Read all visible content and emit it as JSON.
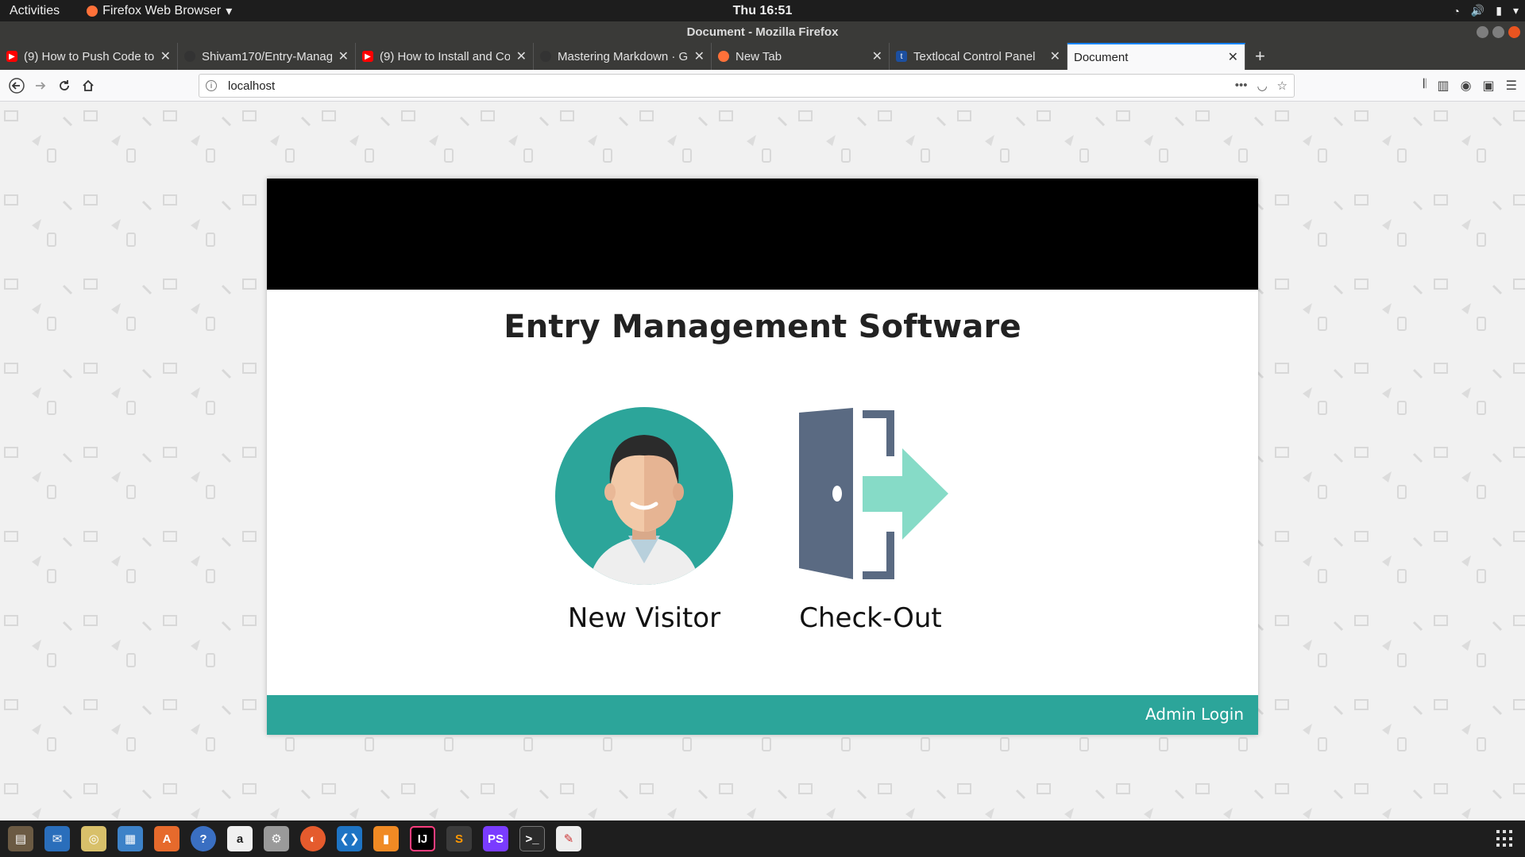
{
  "topbar": {
    "activities": "Activities",
    "app_name": "Firefox Web Browser",
    "clock": "Thu 16:51"
  },
  "window": {
    "title": "Document - Mozilla Firefox"
  },
  "tabs": [
    {
      "label": "(9) How to Push Code to",
      "favicon": "youtube-icon",
      "color": "#ff0000"
    },
    {
      "label": "Shivam170/Entry-Manag",
      "favicon": "github-icon",
      "color": "#333333"
    },
    {
      "label": "(9) How to Install and Co",
      "favicon": "youtube-icon",
      "color": "#ff0000"
    },
    {
      "label": "Mastering Markdown · G",
      "favicon": "github-icon",
      "color": "#333333"
    },
    {
      "label": "New Tab",
      "favicon": "firefox-icon",
      "color": "#ff7139"
    },
    {
      "label": "Textlocal Control Panel",
      "favicon": "textlocal-icon",
      "color": "#1c4fa0"
    },
    {
      "label": "Document",
      "favicon": "none",
      "color": "#f9f9fa",
      "active": true
    }
  ],
  "navbar": {
    "url": "localhost"
  },
  "page": {
    "title": "Entry Management Software",
    "new_visitor_label": "New Visitor",
    "checkout_label": "Check-Out",
    "admin_login": "Admin Login",
    "accent_color": "#2ca59a"
  },
  "taskbar": {
    "apps": [
      "files-icon",
      "thunderbird-icon",
      "rhythmbox-icon",
      "libreoffice-writer-icon",
      "software-center-icon",
      "help-icon",
      "amazon-icon",
      "settings-icon",
      "firefox-icon",
      "vscode-icon",
      "sublime-merge-icon",
      "intellij-icon",
      "sublime-text-icon",
      "phpstorm-icon",
      "terminal-icon",
      "text-editor-icon"
    ]
  }
}
